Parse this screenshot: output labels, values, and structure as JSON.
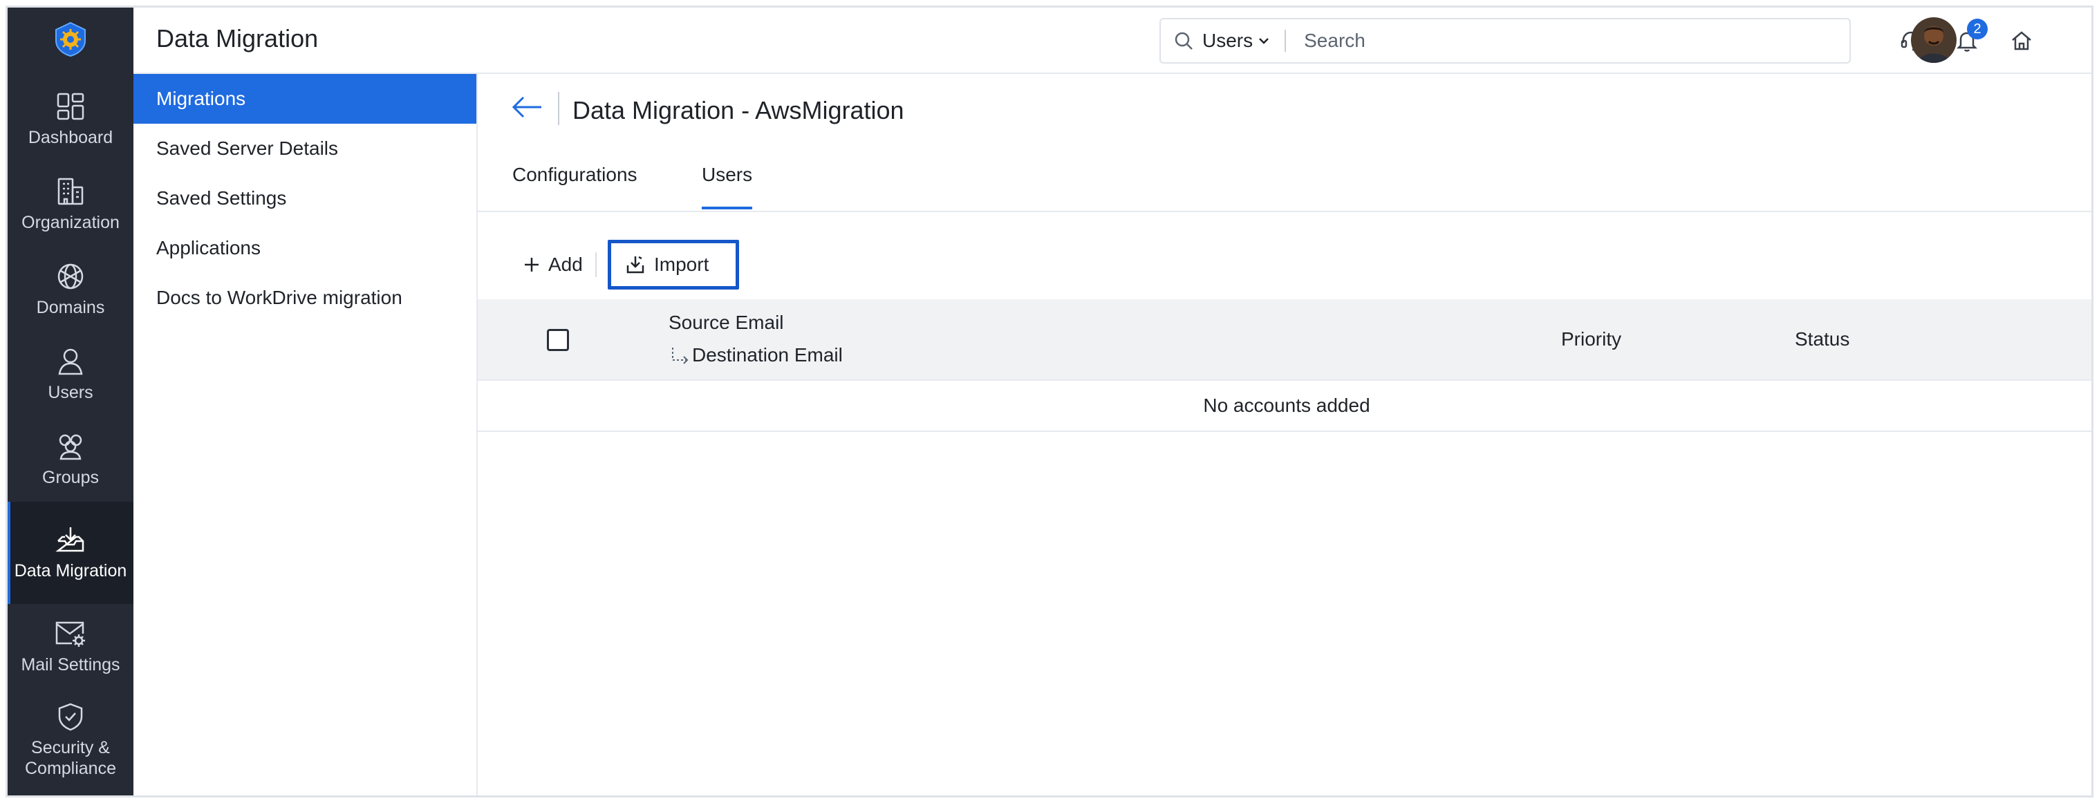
{
  "app": {
    "title": "Data Migration"
  },
  "colors": {
    "accent": "#1f6be0",
    "rail_bg": "#252a35",
    "highlight_border": "#1556c9"
  },
  "rail": {
    "logo_icon": "gear-shield-logo-icon",
    "items": [
      {
        "label": "Dashboard",
        "icon": "dashboard-icon"
      },
      {
        "label": "Organization",
        "icon": "building-icon"
      },
      {
        "label": "Domains",
        "icon": "globe-icon"
      },
      {
        "label": "Users",
        "icon": "user-icon"
      },
      {
        "label": "Groups",
        "icon": "group-icon"
      },
      {
        "label": "Data Migration",
        "icon": "inbox-download-icon",
        "active": true
      },
      {
        "label": "Mail Settings",
        "icon": "mail-gear-icon"
      },
      {
        "label": "Security & Compliance",
        "icon": "shield-check-icon"
      }
    ]
  },
  "search": {
    "scope": "Users",
    "placeholder": "Search"
  },
  "header_icons": {
    "support": "headset-icon",
    "notifications": "bell-icon",
    "notification_count": "2",
    "home": "home-icon"
  },
  "subnav": {
    "items": [
      {
        "label": "Migrations",
        "active": true
      },
      {
        "label": "Saved Server Details"
      },
      {
        "label": "Saved Settings"
      },
      {
        "label": "Applications"
      },
      {
        "label": "Docs to WorkDrive migration"
      }
    ]
  },
  "main": {
    "page_title": "Data Migration - AwsMigration",
    "tabs": [
      {
        "label": "Configurations"
      },
      {
        "label": "Users",
        "active": true
      }
    ],
    "toolbar": {
      "add_label": "Add",
      "import_label": "Import"
    },
    "table": {
      "columns": {
        "source": "Source Email",
        "destination": "Destination Email",
        "priority": "Priority",
        "status": "Status"
      },
      "empty_message": "No accounts added"
    }
  }
}
